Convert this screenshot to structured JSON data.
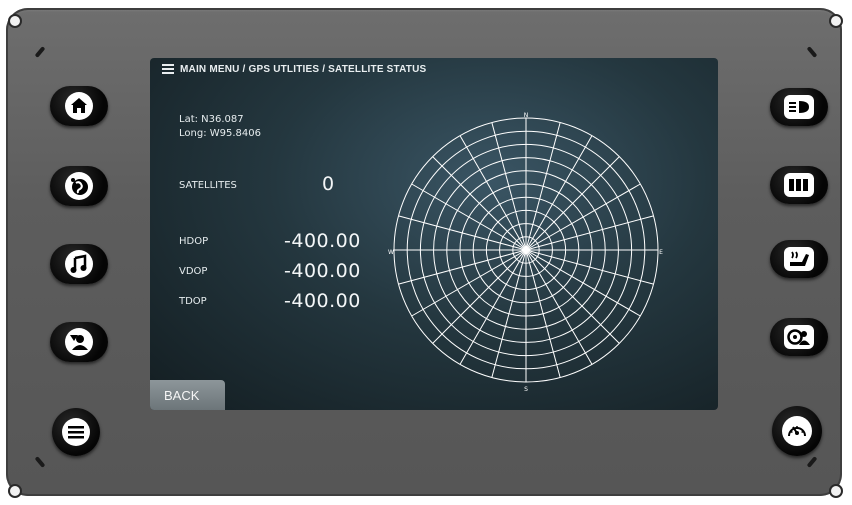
{
  "header": {
    "breadcrumb": "MAIN MENU / GPS UTLITIES / SATELLITE STATUS"
  },
  "position": {
    "lat": "Lat: N36.087",
    "long": "Long: W95.8406"
  },
  "satellites": {
    "label": "SATELLITES",
    "value": "0"
  },
  "dop": [
    {
      "label": "HDOP",
      "value": "-400.00"
    },
    {
      "label": "VDOP",
      "value": "-400.00"
    },
    {
      "label": "TDOP",
      "value": "-400.00"
    }
  ],
  "compass": {
    "n": "N",
    "s": "S",
    "e": "E",
    "w": "W"
  },
  "back_label": "BACK",
  "left_buttons": [
    "home-icon",
    "globe-icon",
    "music-icon",
    "person-icon",
    "menu-icon"
  ],
  "right_buttons": [
    "headlight-icon",
    "battery-icon",
    "seat-heat-icon",
    "steering-icon",
    "gauge-icon"
  ],
  "colors": {
    "screen_bg": "#24373f",
    "bezel": "#5d5d5d",
    "text": "#e6ecee"
  }
}
